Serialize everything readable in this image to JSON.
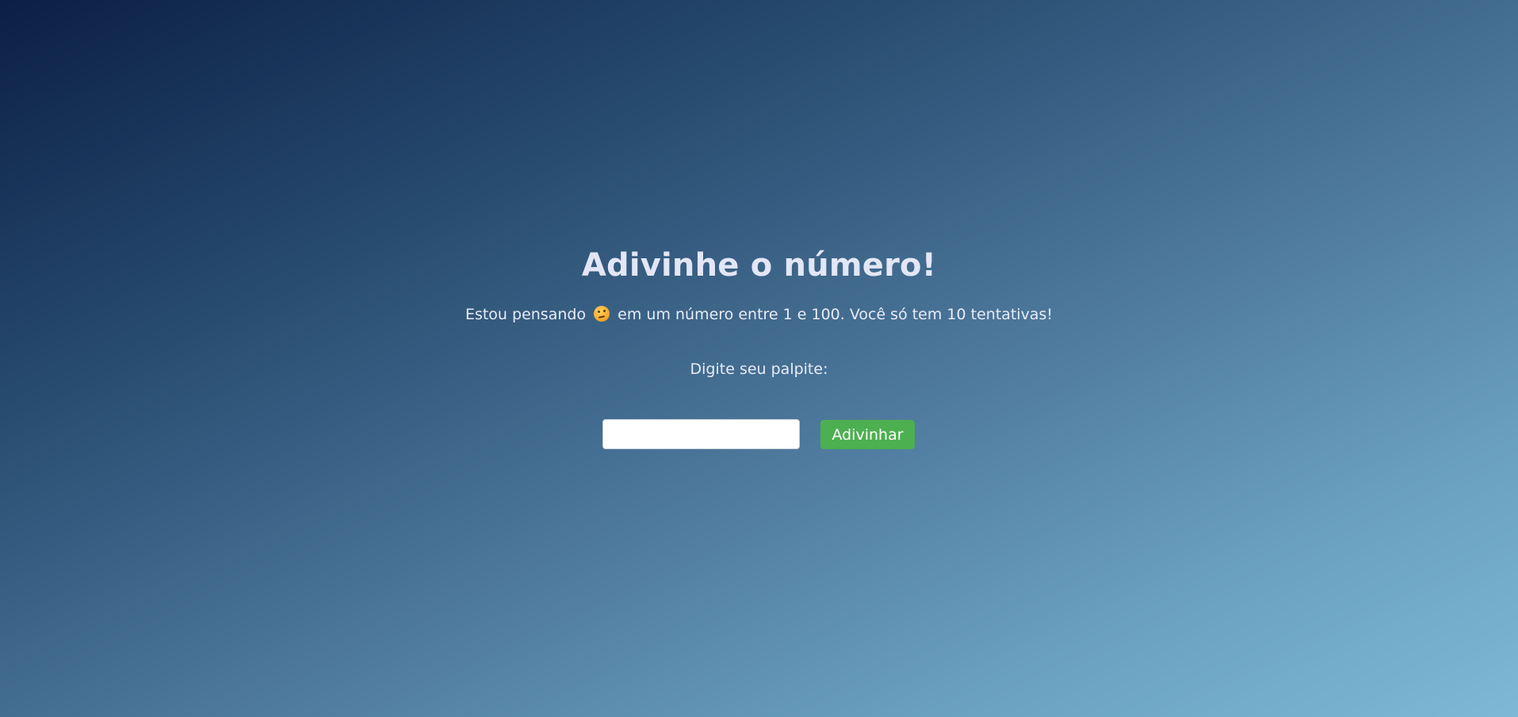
{
  "game": {
    "title": "Adivinhe o número!",
    "subtitle_before": "Estou pensando",
    "subtitle_emoji": "thinking-face-icon",
    "subtitle_after": "em um número entre 1 e 100. Você só tem 10 tentativas!",
    "prompt_label": "Digite seu palpite:",
    "guess_input_value": "",
    "guess_input_placeholder": "",
    "guess_button_label": "Adivinhar"
  },
  "colors": {
    "button_bg": "#4caf50",
    "text": "#e7ecf7",
    "gradient_start": "#0c1f45",
    "gradient_end": "#7db8d6"
  }
}
